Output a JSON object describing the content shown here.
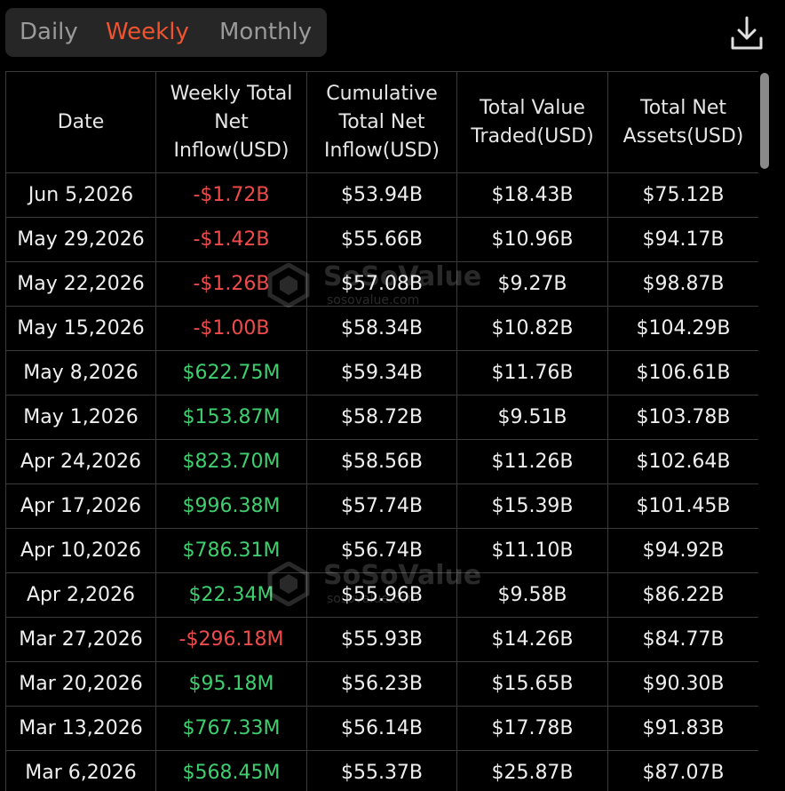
{
  "colors": {
    "accent": "#f0542e",
    "negative": "#ef4b4b",
    "positive": "#3fcf6e"
  },
  "tabs": [
    {
      "label": "Daily",
      "active": false
    },
    {
      "label": "Weekly",
      "active": true
    },
    {
      "label": "Monthly",
      "active": false
    }
  ],
  "toolbar": {
    "download_icon": "download-icon"
  },
  "table": {
    "headers": [
      [
        "Date"
      ],
      [
        "Weekly Total",
        "Net",
        "Inflow(USD)"
      ],
      [
        "Cumulative",
        "Total Net",
        "Inflow(USD)"
      ],
      [
        "Total Value",
        "Traded(USD)"
      ],
      [
        "Total Net",
        "Assets(USD)"
      ]
    ],
    "rows": [
      {
        "date": "Jun 5,2026",
        "weekly": "-$1.72B",
        "trend": "negative",
        "cumulative": "$53.94B",
        "traded": "$18.43B",
        "assets": "$75.12B"
      },
      {
        "date": "May 29,2026",
        "weekly": "-$1.42B",
        "trend": "negative",
        "cumulative": "$55.66B",
        "traded": "$10.96B",
        "assets": "$94.17B"
      },
      {
        "date": "May 22,2026",
        "weekly": "-$1.26B",
        "trend": "negative",
        "cumulative": "$57.08B",
        "traded": "$9.27B",
        "assets": "$98.87B"
      },
      {
        "date": "May 15,2026",
        "weekly": "-$1.00B",
        "trend": "negative",
        "cumulative": "$58.34B",
        "traded": "$10.82B",
        "assets": "$104.29B"
      },
      {
        "date": "May 8,2026",
        "weekly": "$622.75M",
        "trend": "positive",
        "cumulative": "$59.34B",
        "traded": "$11.76B",
        "assets": "$106.61B"
      },
      {
        "date": "May 1,2026",
        "weekly": "$153.87M",
        "trend": "positive",
        "cumulative": "$58.72B",
        "traded": "$9.51B",
        "assets": "$103.78B"
      },
      {
        "date": "Apr 24,2026",
        "weekly": "$823.70M",
        "trend": "positive",
        "cumulative": "$58.56B",
        "traded": "$11.26B",
        "assets": "$102.64B"
      },
      {
        "date": "Apr 17,2026",
        "weekly": "$996.38M",
        "trend": "positive",
        "cumulative": "$57.74B",
        "traded": "$15.39B",
        "assets": "$101.45B"
      },
      {
        "date": "Apr 10,2026",
        "weekly": "$786.31M",
        "trend": "positive",
        "cumulative": "$56.74B",
        "traded": "$11.10B",
        "assets": "$94.92B"
      },
      {
        "date": "Apr 2,2026",
        "weekly": "$22.34M",
        "trend": "positive",
        "cumulative": "$55.96B",
        "traded": "$9.58B",
        "assets": "$86.22B"
      },
      {
        "date": "Mar 27,2026",
        "weekly": "-$296.18M",
        "trend": "negative",
        "cumulative": "$55.93B",
        "traded": "$14.26B",
        "assets": "$84.77B"
      },
      {
        "date": "Mar 20,2026",
        "weekly": "$95.18M",
        "trend": "positive",
        "cumulative": "$56.23B",
        "traded": "$15.65B",
        "assets": "$90.30B"
      },
      {
        "date": "Mar 13,2026",
        "weekly": "$767.33M",
        "trend": "positive",
        "cumulative": "$56.14B",
        "traded": "$17.78B",
        "assets": "$91.83B"
      },
      {
        "date": "Mar 6,2026",
        "weekly": "$568.45M",
        "trend": "positive",
        "cumulative": "$55.37B",
        "traded": "$25.87B",
        "assets": "$87.07B"
      }
    ]
  },
  "watermark": {
    "brand": "SoSoValue",
    "url": "sosovalue.com",
    "logo_icon": "sosovalue-logo-icon"
  }
}
